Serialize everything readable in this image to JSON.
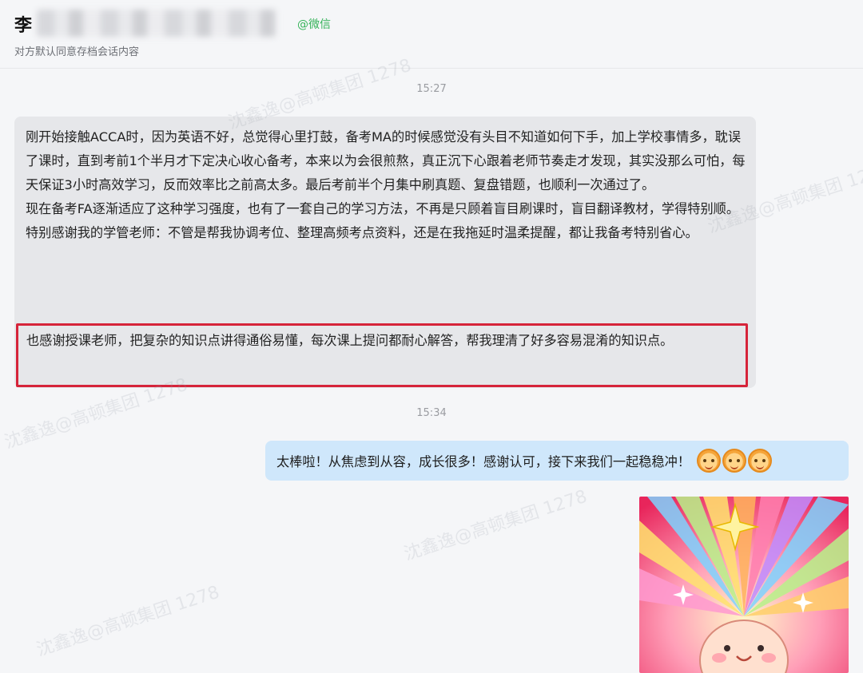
{
  "header": {
    "contact_name": "李",
    "platform_tag": "@微信",
    "consent_note": "对方默认同意存档会话内容"
  },
  "messages": [
    {
      "time": "15:27",
      "direction": "incoming",
      "paragraphs": [
        "刚开始接触ACCA时，因为英语不好，总觉得心里打鼓，备考MA的时候感觉没有头目不知道如何下手，加上学校事情多，耽误了课时，直到考前1个半月才下定决心收心备考，本来以为会很煎熬，真正沉下心跟着老师节奏走才发现，其实没那么可怕，每天保证3小时高效学习，反而效率比之前高太多。最后考前半个月集中刷真题、复盘错题，也顺利一次通过了。",
        "现在备考FA逐渐适应了这种学习强度，也有了一套自己的学习方法，不再是只顾着盲目刷课时，盲目翻译教材，学得特别顺。",
        "特别感谢我的学管老师：不管是帮我协调考位、整理高频考点资料，还是在我拖延时温柔提醒，都让我备考特别省心。"
      ],
      "highlighted": "也感谢授课老师，把复杂的知识点讲得通俗易懂，每次课上提问都耐心解答，帮我理清了好多容易混淆的知识点。"
    },
    {
      "time": "15:34",
      "direction": "outgoing",
      "text": "太棒啦！从焦虑到从容，成长很多！感谢认可，接下来我们一起稳稳冲！",
      "emoji_icons": [
        "celebrate-face-icon",
        "celebrate-face-icon",
        "celebrate-face-icon"
      ]
    }
  ],
  "sticker": {
    "icon": "rainbow-burst-sticker"
  },
  "watermark": {
    "text": "沈鑫逸@高顿集团 1278"
  },
  "colors": {
    "incoming_bubble": "#e6e7ea",
    "outgoing_bubble": "#cfe7fb",
    "highlight_border": "#d6243a",
    "platform_tag": "#36b35a"
  }
}
